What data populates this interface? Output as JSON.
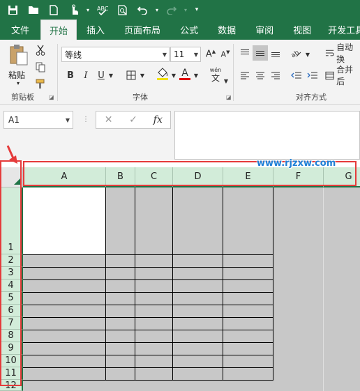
{
  "quick_access": {
    "icons": [
      "save-icon",
      "open-folder-icon",
      "new-file-icon",
      "touch-mode-icon",
      "chevron-down-icon",
      "spelling-check-icon",
      "print-preview-icon",
      "undo-icon",
      "chevron-down-icon",
      "redo-icon",
      "chevron-down-icon",
      "customize-icon"
    ]
  },
  "tabs": [
    {
      "label": "文件",
      "active": false
    },
    {
      "label": "开始",
      "active": true
    },
    {
      "label": "插入",
      "active": false
    },
    {
      "label": "页面布局",
      "active": false
    },
    {
      "label": "公式",
      "active": false
    },
    {
      "label": "数据",
      "active": false
    },
    {
      "label": "审阅",
      "active": false
    },
    {
      "label": "视图",
      "active": false
    },
    {
      "label": "开发工具",
      "active": false
    }
  ],
  "ribbon": {
    "clipboard": {
      "paste_label": "粘贴",
      "group_label": "剪贴板"
    },
    "font": {
      "font_name": "等线",
      "font_size": "11",
      "bold": "B",
      "italic": "I",
      "underline": "U",
      "font_color_glyph": "A",
      "phonetic": "wén",
      "group_label": "字体"
    },
    "alignment": {
      "wrap_label": "自动换",
      "merge_label": "合并后",
      "group_label": "对齐方式"
    }
  },
  "formula_bar": {
    "name_box": "A1",
    "fx": "fx",
    "cancel": "✕",
    "enter": "✓",
    "formula": ""
  },
  "sheet": {
    "columns": [
      "A",
      "B",
      "C",
      "D",
      "E",
      "F",
      "G"
    ],
    "rows": [
      "1",
      "2",
      "3",
      "4",
      "5",
      "6",
      "7",
      "8",
      "9",
      "10",
      "11",
      "12"
    ]
  },
  "watermark": "www.rjzxw.com",
  "colors": {
    "accent": "#217346",
    "header_bg": "#d2ecd9",
    "highlight": "#e53b3b",
    "cell_fill": "#c8c8c8"
  }
}
